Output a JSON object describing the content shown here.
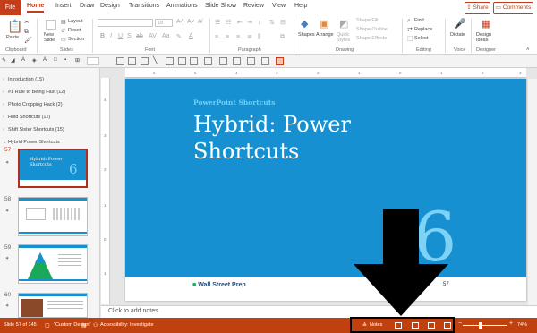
{
  "tabs": [
    "File",
    "Home",
    "Insert",
    "Draw",
    "Design",
    "Transitions",
    "Animations",
    "Slide Show",
    "Review",
    "View",
    "Help"
  ],
  "header_buttons": {
    "share": "Share",
    "comments": "Comments"
  },
  "ribbon": {
    "groups": [
      "Clipboard",
      "Slides",
      "Font",
      "Paragraph",
      "Drawing",
      "Editing",
      "Voice",
      "Designer"
    ],
    "paste": "Paste",
    "new_slide": "New\nSlide",
    "layout": "Layout",
    "reset": "Reset",
    "section": "Section",
    "font_size": "18",
    "shapes": "Shapes",
    "arrange": "Arrange",
    "quick_styles": "Quick\nStyles",
    "shape_fill": "Shape Fill",
    "shape_outline": "Shape Outline",
    "shape_effects": "Shape Effects",
    "find": "Find",
    "replace": "Replace",
    "select": "Select",
    "dictate": "Dictate",
    "design_ideas": "Design\nIdeas"
  },
  "outline": [
    {
      "label": "Introduction (15)"
    },
    {
      "label": "#1 Rule to Being Fast (12)"
    },
    {
      "label": "Photo Cropping Hack (2)"
    },
    {
      "label": "Hold Shortcuts (12)"
    },
    {
      "label": "Shift Sister Shortcuts (15)"
    },
    {
      "label": "Hybrid Power Shortcuts"
    }
  ],
  "thumbnails": [
    {
      "num": "57",
      "title": "Hybrid: Power Shortcuts",
      "big": "6"
    },
    {
      "num": "58"
    },
    {
      "num": "59"
    },
    {
      "num": "60"
    }
  ],
  "slide": {
    "subtitle": "PowerPoint Shortcuts",
    "title": "Hybrid: Power Shortcuts",
    "big_number": "6",
    "logo": "Wall Street Prep",
    "page_number": "57"
  },
  "notes_placeholder": "Click to add notes",
  "status": {
    "slide_info": "Slide 57 of 145",
    "theme": "\"Custom Design\"",
    "accessibility": "Accessibility: Investigate",
    "notes": "Notes",
    "zoom": "74%"
  },
  "colors": {
    "accent": "#c43e1c",
    "slide_blue": "#1690d0",
    "status_bar": "#c1410e"
  }
}
